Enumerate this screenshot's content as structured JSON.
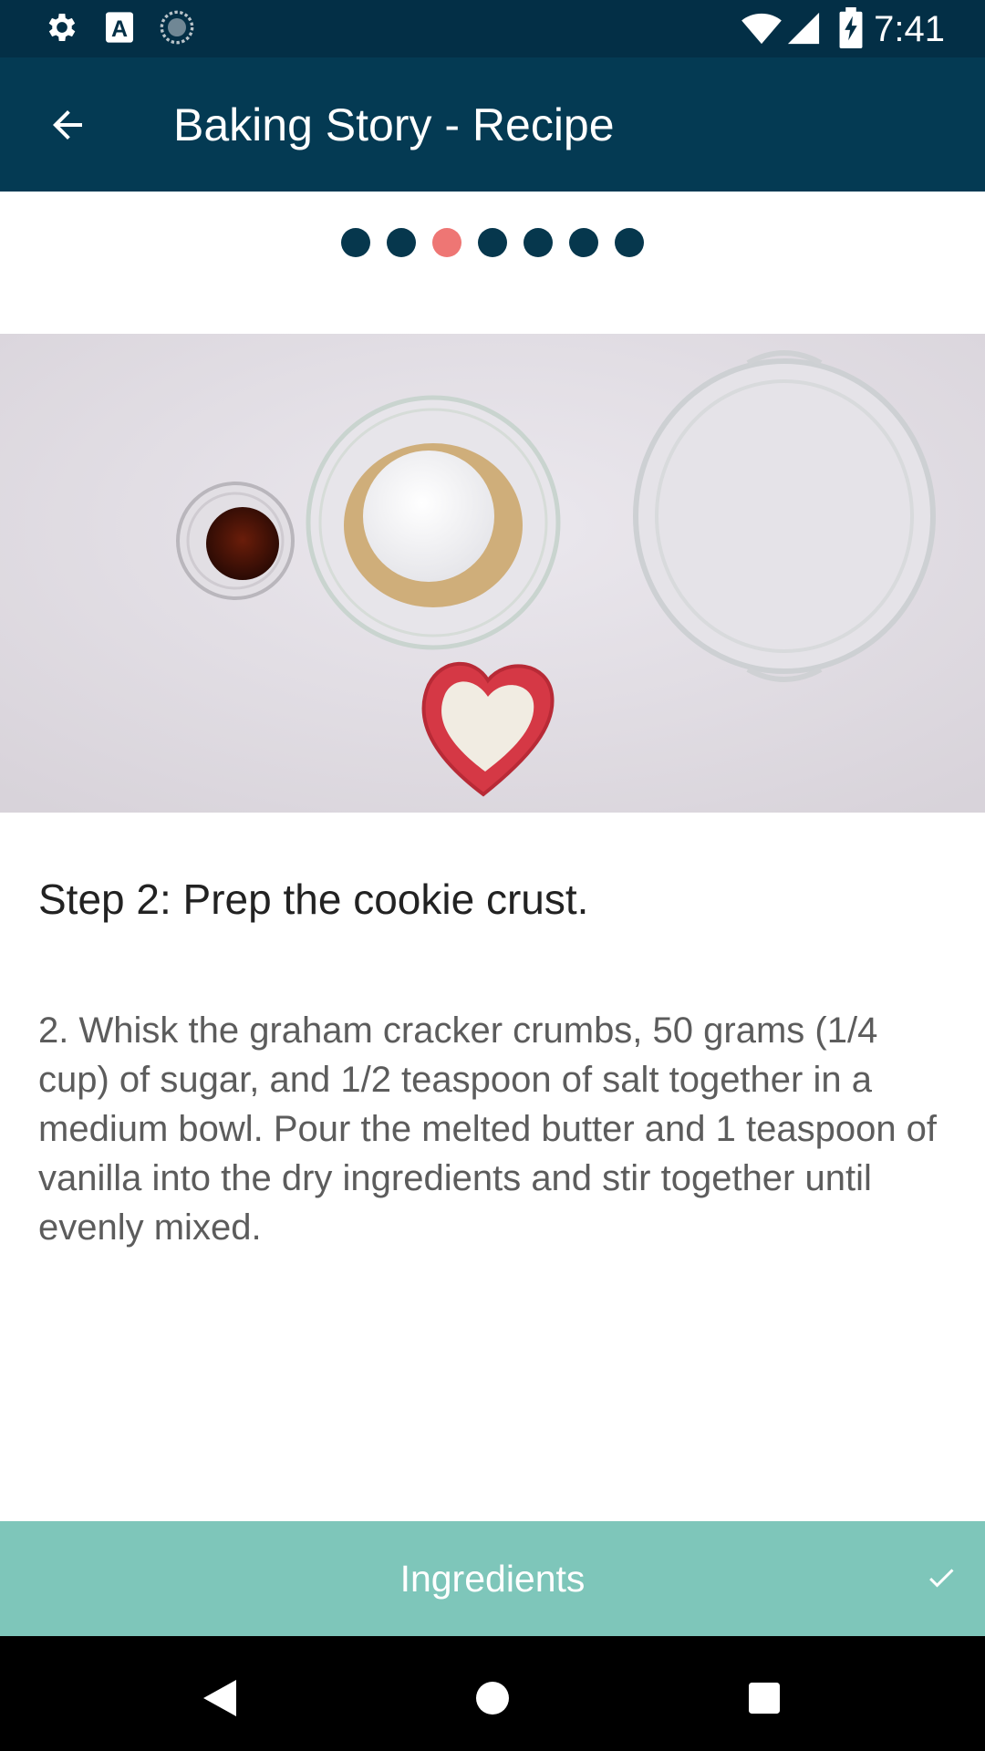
{
  "status_bar": {
    "time": "7:41",
    "left_icons": [
      "gear-icon",
      "a-font-icon",
      "sync-spinner-icon"
    ],
    "right_icons": [
      "wifi-icon",
      "signal-icon",
      "battery-charging-icon"
    ]
  },
  "app_bar": {
    "title": "Baking Story - Recipe",
    "back_icon": "arrow-left-icon"
  },
  "pager": {
    "total": 7,
    "active_index": 2,
    "colors": {
      "dot": "#06374d",
      "active": "#ee7674"
    }
  },
  "hero_image": {
    "description_icon": "recipe-step-photo"
  },
  "step": {
    "title": "Step 2: Prep the cookie crust.",
    "body": "2. Whisk the graham cracker crumbs, 50 grams (1/4 cup) of sugar, and 1/2 teaspoon of salt together in a medium bowl. Pour the melted butter and 1 teaspoon of vanilla into the dry ingredients and stir together until evenly mixed."
  },
  "ingredients_bar": {
    "label": "Ingredients",
    "icon": "check-icon",
    "color": "#7ec6ba"
  },
  "nav_bar": {
    "buttons": [
      "back-triangle-icon",
      "home-circle-icon",
      "recents-square-icon"
    ]
  },
  "theme": {
    "primary": "#043a53",
    "status": "#032f46",
    "accent": "#ee7674"
  }
}
